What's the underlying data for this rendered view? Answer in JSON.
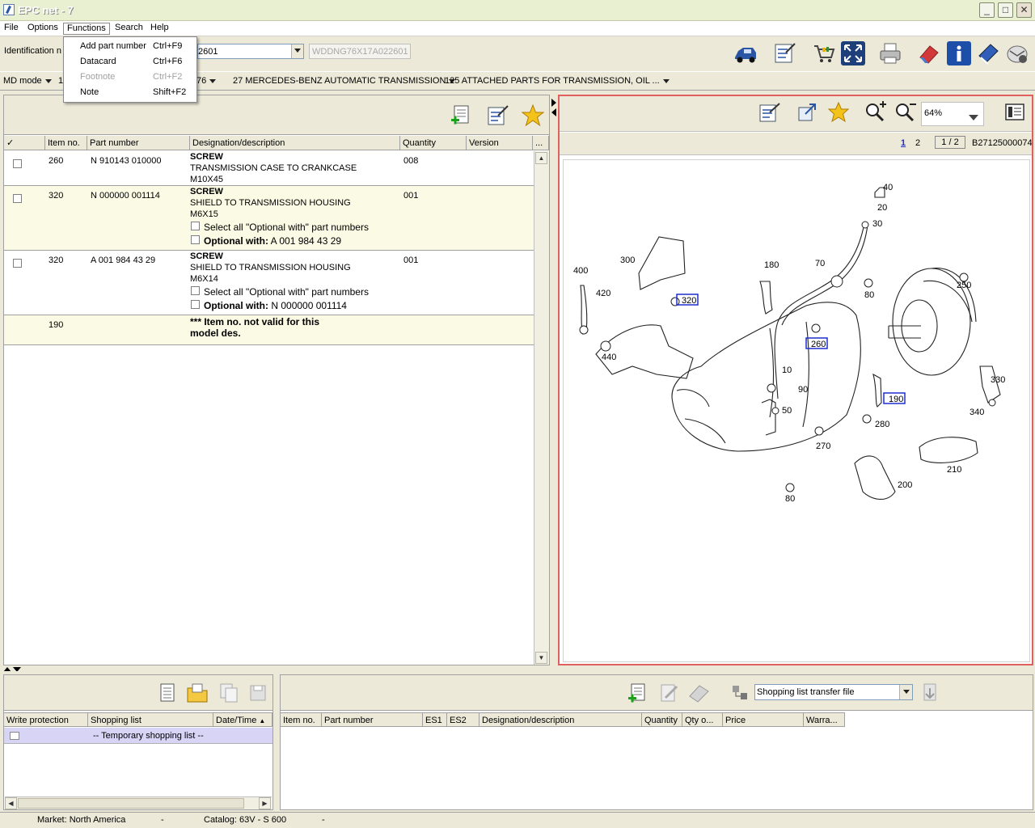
{
  "window": {
    "title": "EPC net - 7",
    "minimize": "_",
    "maximize": "□",
    "close": "✕"
  },
  "menu": [
    "File",
    "Options",
    "Functions",
    "Search",
    "Help"
  ],
  "functions_menu": [
    {
      "label": "Add part number",
      "shortcut": "Ctrl+F9",
      "enabled": true
    },
    {
      "label": "Datacard",
      "shortcut": "Ctrl+F6",
      "enabled": true
    },
    {
      "label": "Footnote",
      "shortcut": "Ctrl+F2",
      "enabled": false
    },
    {
      "label": "Note",
      "shortcut": "Shift+F2",
      "enabled": true
    }
  ],
  "idbar": {
    "label": "Identification n",
    "combo_value": "2601",
    "vin_placeholder": "WDDNG76X17A022601"
  },
  "toolbar_icons": [
    "vehicle-icon",
    "checklist-icon",
    "shopping-cart-icon",
    "fullscreen-icon",
    "printer-icon",
    "eraser-icon",
    "info-icon",
    "manual-icon",
    "mail-icon"
  ],
  "modebar": {
    "mode": "MD mode",
    "item1": "1",
    "item2": "76",
    "group": "27 MERCEDES-BENZ AUTOMATIC TRANSMISSION",
    "subgroup": "125 ATTACHED PARTS FOR TRANSMISSION, OIL ..."
  },
  "parts_table": {
    "headers": {
      "check": "✓",
      "item": "Item no.",
      "part": "Part number",
      "desc": "Designation/description",
      "qty": "Quantity",
      "version": "Version",
      "more": "..."
    },
    "rows": [
      {
        "item": "260",
        "part": "N 910143 010000",
        "name": "SCREW",
        "desc1": "TRANSMISSION CASE TO CRANKCASE",
        "desc2": "M10X45",
        "qty": "008"
      },
      {
        "item": "320",
        "part": "N 000000 001114",
        "name": "SCREW",
        "desc1": "SHIELD TO TRANSMISSION HOUSING",
        "desc2": "M6X15",
        "qty": "001",
        "select_all": "Select all \"Optional with\" part numbers",
        "optional_label": "Optional with:",
        "optional_value": "A 001 984 43 29"
      },
      {
        "item": "320",
        "part": "A 001 984 43 29",
        "name": "SCREW",
        "desc1": "SHIELD TO TRANSMISSION HOUSING",
        "desc2": "M6X14",
        "qty": "001",
        "select_all": "Select all \"Optional with\" part numbers",
        "optional_label": "Optional with:",
        "optional_value": "N 000000 001114"
      },
      {
        "item": "190",
        "note1": "*** Item no. not valid for this",
        "note2": "model des."
      }
    ]
  },
  "viewer": {
    "zoom": "64%",
    "page1": "1",
    "page2": "2",
    "page_of": "1 / 2",
    "drawing_id": "B27125000074"
  },
  "diagram_labels": [
    {
      "text": "40"
    },
    {
      "text": "20"
    },
    {
      "text": "30"
    },
    {
      "text": "70"
    },
    {
      "text": "80"
    },
    {
      "text": "250"
    },
    {
      "text": "400"
    },
    {
      "text": "300"
    },
    {
      "text": "180"
    },
    {
      "text": "420"
    },
    {
      "text": "320",
      "boxed": true
    },
    {
      "text": "260",
      "boxed": true
    },
    {
      "text": "440"
    },
    {
      "text": "10"
    },
    {
      "text": "90"
    },
    {
      "text": "50"
    },
    {
      "text": "190",
      "boxed": true
    },
    {
      "text": "330"
    },
    {
      "text": "340"
    },
    {
      "text": "280"
    },
    {
      "text": "270"
    },
    {
      "text": "210"
    },
    {
      "text": "200"
    },
    {
      "text": "80"
    }
  ],
  "shopping": {
    "headers": {
      "write_protection": "Write protection",
      "list": "Shopping list",
      "date": "Date/Time"
    },
    "row": {
      "list": "-- Temporary shopping list --"
    }
  },
  "transfer": {
    "combo": "Shopping list transfer file"
  },
  "cart_headers": [
    "Item no.",
    "Part number",
    "ES1",
    "ES2",
    "Designation/description",
    "Quantity",
    "Qty o...",
    "Price",
    "Warra..."
  ],
  "status": {
    "market": "Market: North America",
    "sep1": "-",
    "catalog": "Catalog: 63V - S 600",
    "sep2": "-"
  },
  "colors": {
    "accent": "#2a55a5",
    "highlight_row": "#fbfbe5",
    "selected_row": "#d8d4f5",
    "viewer_border": "#e06060",
    "callout_box": "#1d2fd0"
  }
}
